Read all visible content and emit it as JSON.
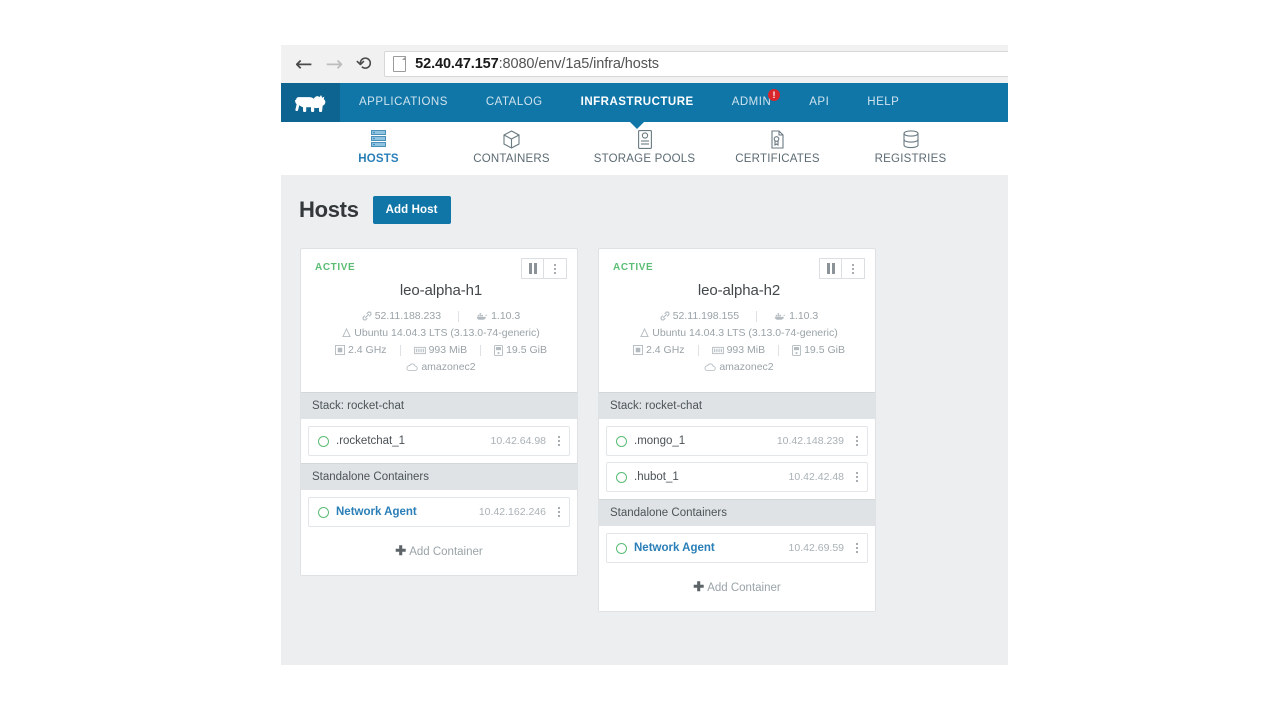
{
  "browser": {
    "back_icon": "back-arrow-icon",
    "forward_icon": "forward-arrow-icon",
    "reload_icon": "reload-icon",
    "page_icon": "page-icon",
    "url_host": "52.40.47.157",
    "url_path": ":8080/env/1a5/infra/hosts"
  },
  "topnav": {
    "logo": "rancher-cow-logo",
    "items": [
      {
        "label": "APPLICATIONS",
        "active": false,
        "badge": null
      },
      {
        "label": "CATALOG",
        "active": false,
        "badge": null
      },
      {
        "label": "INFRASTRUCTURE",
        "active": true,
        "badge": null
      },
      {
        "label": "ADMIN",
        "active": false,
        "badge": "!"
      },
      {
        "label": "API",
        "active": false,
        "badge": null
      },
      {
        "label": "HELP",
        "active": false,
        "badge": null
      }
    ]
  },
  "subnav": {
    "items": [
      {
        "label": "HOSTS",
        "icon": "server-rack-icon",
        "active": true
      },
      {
        "label": "CONTAINERS",
        "icon": "cube-icon",
        "active": false
      },
      {
        "label": "STORAGE POOLS",
        "icon": "storage-icon",
        "active": false
      },
      {
        "label": "CERTIFICATES",
        "icon": "certificate-icon",
        "active": false
      },
      {
        "label": "REGISTRIES",
        "icon": "database-icon",
        "active": false
      }
    ]
  },
  "page": {
    "title": "Hosts",
    "add_host_label": "Add Host"
  },
  "colors": {
    "brand_blue": "#1076a8",
    "logo_blue": "#0e6491",
    "active_green": "#5bbd75",
    "badge_red": "#d9262c",
    "link_blue": "#2a7fb8",
    "canvas_gray": "#eceeef",
    "section_gray": "#dfe3e5"
  },
  "hosts": [
    {
      "state": "ACTIVE",
      "name": "leo-alpha-h1",
      "ip": "52.11.188.233",
      "docker_version": "1.10.3",
      "os": "Ubuntu 14.04.3 LTS (3.13.0-74-generic)",
      "cpu": "2.4 GHz",
      "memory": "993 MiB",
      "disk": "19.5 GiB",
      "driver": "amazonec2",
      "pause_button": "pause-button",
      "menu_button": "host-menu-button",
      "sections": [
        {
          "title": "Stack: rocket-chat",
          "type": "stack",
          "rows": [
            {
              "name": ".rocketchat_1",
              "ip": "10.42.64.98",
              "state": "running",
              "link": false
            }
          ],
          "add_label": null
        },
        {
          "title": "Standalone Containers",
          "type": "standalone",
          "rows": [
            {
              "name": "Network Agent",
              "ip": "10.42.162.246",
              "state": "running",
              "link": true
            }
          ],
          "add_label": "Add Container"
        }
      ]
    },
    {
      "state": "ACTIVE",
      "name": "leo-alpha-h2",
      "ip": "52.11.198.155",
      "docker_version": "1.10.3",
      "os": "Ubuntu 14.04.3 LTS (3.13.0-74-generic)",
      "cpu": "2.4 GHz",
      "memory": "993 MiB",
      "disk": "19.5 GiB",
      "driver": "amazonec2",
      "pause_button": "pause-button",
      "menu_button": "host-menu-button",
      "sections": [
        {
          "title": "Stack: rocket-chat",
          "type": "stack",
          "rows": [
            {
              "name": ".mongo_1",
              "ip": "10.42.148.239",
              "state": "running",
              "link": false
            },
            {
              "name": ".hubot_1",
              "ip": "10.42.42.48",
              "state": "running",
              "link": false
            }
          ],
          "add_label": null
        },
        {
          "title": "Standalone Containers",
          "type": "standalone",
          "rows": [
            {
              "name": "Network Agent",
              "ip": "10.42.69.59",
              "state": "running",
              "link": true
            }
          ],
          "add_label": "Add Container"
        }
      ]
    }
  ]
}
